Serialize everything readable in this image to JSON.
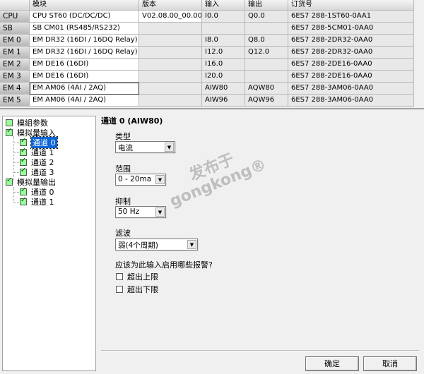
{
  "table": {
    "headers": [
      "",
      "模块",
      "版本",
      "输入",
      "输出",
      "订货号"
    ],
    "rows": [
      [
        "CPU",
        "CPU ST60 (DC/DC/DC)",
        "V02.08.00_00.00...",
        "I0.0",
        "Q0.0",
        "6ES7 288-1ST60-0AA1"
      ],
      [
        "SB",
        "SB CM01 (RS485/RS232)",
        "",
        "",
        "",
        "6ES7 288-5CM01-0AA0"
      ],
      [
        "EM 0",
        "EM DR32 (16DI / 16DQ Relay)",
        "",
        "I8.0",
        "Q8.0",
        "6ES7 288-2DR32-0AA0"
      ],
      [
        "EM 1",
        "EM DR32 (16DI / 16DQ Relay)",
        "",
        "I12.0",
        "Q12.0",
        "6ES7 288-2DR32-0AA0"
      ],
      [
        "EM 2",
        "EM DE16 (16DI)",
        "",
        "I16.0",
        "",
        "6ES7 288-2DE16-0AA0"
      ],
      [
        "EM 3",
        "EM DE16 (16DI)",
        "",
        "I20.0",
        "",
        "6ES7 288-2DE16-0AA0"
      ],
      [
        "EM 4",
        "EM AM06 (4AI / 2AQ)",
        "",
        "AIW80",
        "AQW80",
        "6ES7 288-3AM06-0AA0"
      ],
      [
        "EM 5",
        "EM AM06 (4AI / 2AQ)",
        "",
        "AIW96",
        "AQW96",
        "6ES7 288-3AM06-0AA0"
      ]
    ]
  },
  "tree": {
    "module_params": "模組参数",
    "analog_in": "模拟量输入",
    "in_channels": [
      "通道 0",
      "通道 1",
      "通道 2",
      "通道 3"
    ],
    "analog_out": "模拟量输出",
    "out_channels": [
      "通道 0",
      "通道 1"
    ]
  },
  "form": {
    "title": "通道 0 (AIW80)",
    "type_label": "类型",
    "type_value": "电流",
    "range_label": "范围",
    "range_value": "0 - 20ma",
    "reject_label": "抑制",
    "reject_value": "50 Hz",
    "filter_label": "滤波",
    "filter_value": "弱(4个周期)",
    "alarm_question": "应该为此输入启用哪些报警?",
    "alarm_high": "超出上限",
    "alarm_low": "超出下限"
  },
  "buttons": {
    "ok": "确定",
    "cancel": "取消"
  },
  "watermark": {
    "line1": "发布于",
    "line2": "gongkong®"
  }
}
